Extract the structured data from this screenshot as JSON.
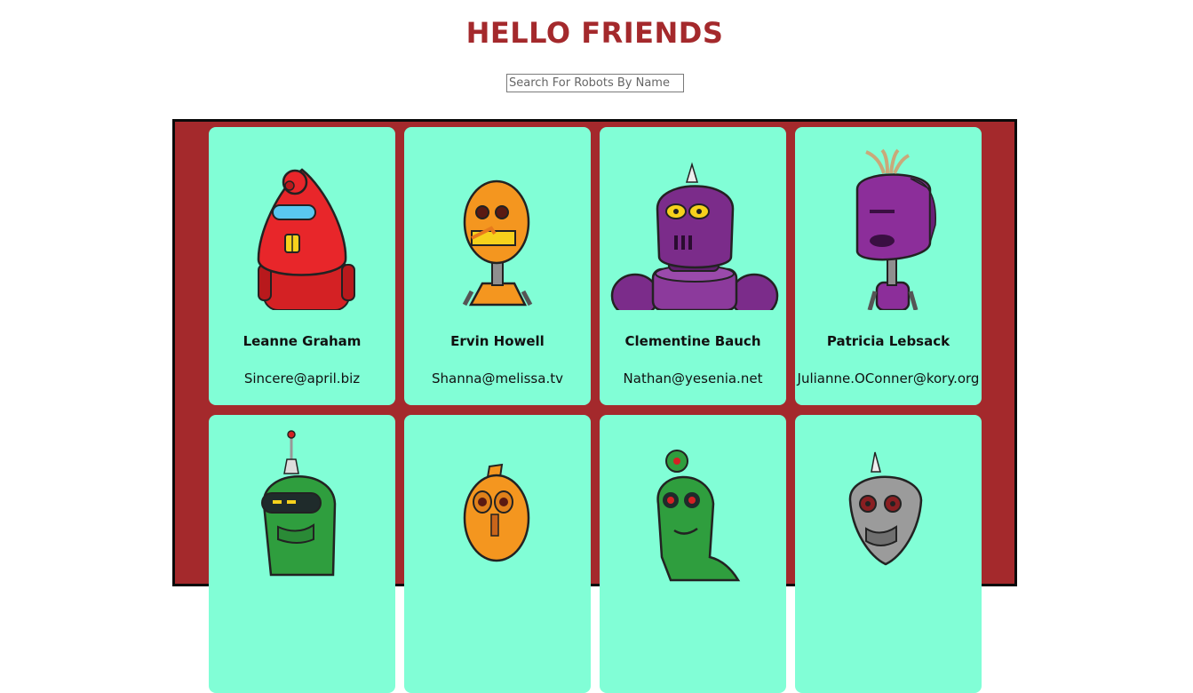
{
  "header": {
    "title": "HELLO FRIENDS"
  },
  "search": {
    "placeholder": "Search For Robots By Name ...",
    "value": ""
  },
  "colors": {
    "background": "#ffffff",
    "title": "#a4292c",
    "grid": "#a4292c",
    "card": "#81fed6"
  },
  "robots": [
    {
      "name": "Leanne Graham",
      "email": "Sincere@april.biz",
      "robot_color": "#e8262a"
    },
    {
      "name": "Ervin Howell",
      "email": "Shanna@melissa.tv",
      "robot_color": "#f4961f"
    },
    {
      "name": "Clementine Bauch",
      "email": "Nathan@yesenia.net",
      "robot_color": "#7b2c8a"
    },
    {
      "name": "Patricia Lebsack",
      "email": "Julianne.OConner@kory.org",
      "robot_color": "#8c2e9a"
    },
    {
      "name": "",
      "email": "",
      "robot_color": "#2f9e3e"
    },
    {
      "name": "",
      "email": "",
      "robot_color": "#f4961f"
    },
    {
      "name": "",
      "email": "",
      "robot_color": "#2f9e3e"
    },
    {
      "name": "",
      "email": "",
      "robot_color": "#9b9b9b"
    }
  ]
}
